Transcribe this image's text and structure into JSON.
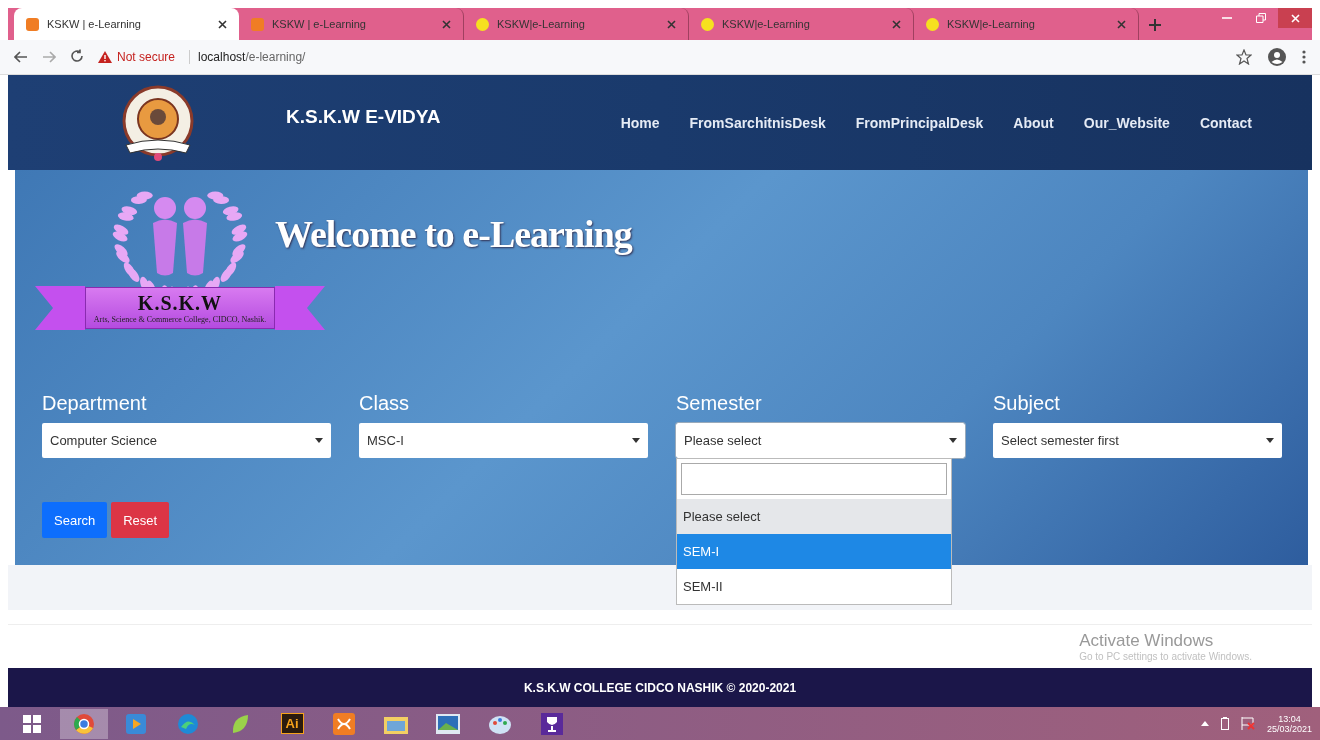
{
  "browser": {
    "tabs": [
      {
        "title": "KSKW | e-Learning",
        "selected": true,
        "kind": "app"
      },
      {
        "title": "KSKW | e-Learning",
        "selected": false,
        "kind": "app"
      },
      {
        "title": "KSKW|e-Learning",
        "selected": false,
        "kind": "dot"
      },
      {
        "title": "KSKW|e-Learning",
        "selected": false,
        "kind": "dot"
      },
      {
        "title": "KSKW|e-Learning",
        "selected": false,
        "kind": "dot"
      }
    ],
    "address": {
      "warning": "Not secure",
      "host": "localhost",
      "path": "/e-learning/"
    }
  },
  "header": {
    "brand": "K.S.K.W E-VIDYA",
    "nav": [
      "Home",
      "FromSarchitnisDesk",
      "FromPrincipalDesk",
      "About",
      "Our_Website",
      "Contact"
    ]
  },
  "hero": {
    "title": "Welcome to e-Learning",
    "emblem": {
      "name": "K.S.K.W",
      "subtitle": "Arts, Science & Commerce College, CIDCO, Nashik."
    }
  },
  "filters": [
    {
      "label": "Department",
      "value": "Computer Science",
      "open": false
    },
    {
      "label": "Class",
      "value": "MSC-I",
      "open": false
    },
    {
      "label": "Semester",
      "value": "Please select",
      "open": true,
      "options": [
        {
          "label": "Please select",
          "selected": true,
          "highlighted": false
        },
        {
          "label": "SEM-I",
          "selected": false,
          "highlighted": true
        },
        {
          "label": "SEM-II",
          "selected": false,
          "highlighted": false
        }
      ]
    },
    {
      "label": "Subject",
      "value": "Select semester first",
      "open": false
    }
  ],
  "buttons": [
    {
      "label": "Search",
      "kind": "primary"
    },
    {
      "label": "Reset",
      "kind": "danger"
    }
  ],
  "footer": "K.S.K.W COLLEGE CIDCO NASHIK © 2020-2021",
  "windows_notice": {
    "title": "Activate Windows",
    "subtitle": "Go to PC settings to activate Windows."
  },
  "taskbar": {
    "apps": [
      {
        "kind": "browser",
        "active": true
      },
      {
        "kind": "media",
        "active": false
      },
      {
        "kind": "edge",
        "active": false
      },
      {
        "kind": "leaf",
        "active": false
      },
      {
        "kind": "text",
        "label": "Ai",
        "active": false
      },
      {
        "kind": "xampp",
        "active": false
      },
      {
        "kind": "folder",
        "active": false
      },
      {
        "kind": "photo",
        "active": false
      },
      {
        "kind": "paint",
        "active": false
      },
      {
        "kind": "trophy",
        "active": false
      }
    ],
    "time": "13:04",
    "date": "25/03/2021"
  }
}
